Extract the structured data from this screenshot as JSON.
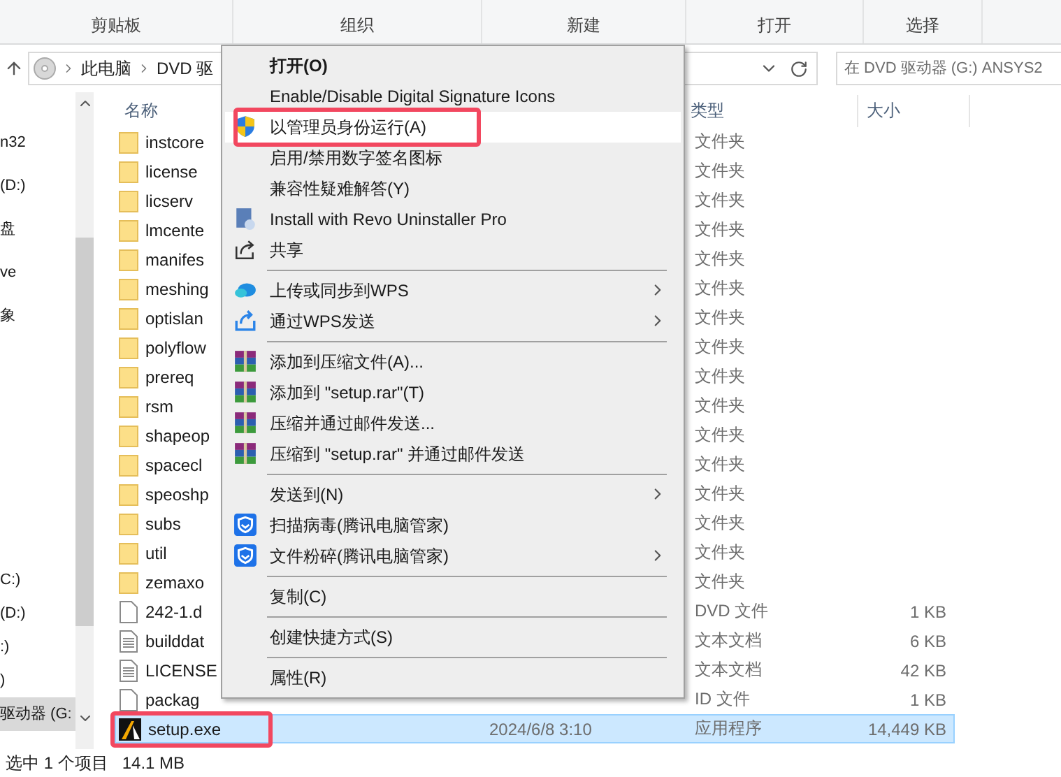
{
  "ribbon_groups": [
    "剪贴板",
    "组织",
    "新建",
    "打开",
    "选择"
  ],
  "address_bar": {
    "crumbs": [
      "此电脑",
      "DVD 驱"
    ]
  },
  "search": {
    "placeholder": "在 DVD 驱动器 (G:) ANSYS2"
  },
  "nav": {
    "upper": [
      {
        "label": "n32",
        "selected": false
      },
      {
        "label": "(D:)",
        "selected": false
      },
      {
        "label": "盘",
        "selected": false
      },
      {
        "label": "ve",
        "selected": false
      },
      {
        "label": "象",
        "selected": false
      }
    ],
    "lower": [
      {
        "label": "C:)",
        "selected": false
      },
      {
        "label": "(D:)",
        "selected": false
      },
      {
        "label": ":)",
        "selected": false
      },
      {
        "label": ")",
        "selected": false
      },
      {
        "label": "驱动器 (G:",
        "selected": true
      }
    ]
  },
  "columns": {
    "name": "名称",
    "type": "类型",
    "size": "大小"
  },
  "files": [
    {
      "kind": "folder",
      "name": "instcore",
      "type": "文件夹",
      "selected": false,
      "annotated": false
    },
    {
      "kind": "folder",
      "name": "license",
      "type": "文件夹",
      "selected": false,
      "annotated": false
    },
    {
      "kind": "folder",
      "name": "licserv",
      "type": "文件夹",
      "selected": false,
      "annotated": false
    },
    {
      "kind": "folder",
      "name": "lmcente",
      "type": "文件夹",
      "selected": false,
      "annotated": false
    },
    {
      "kind": "folder",
      "name": "manifes",
      "type": "文件夹",
      "selected": false,
      "annotated": false
    },
    {
      "kind": "folder",
      "name": "meshing",
      "type": "文件夹",
      "selected": false,
      "annotated": false
    },
    {
      "kind": "folder",
      "name": "optislan",
      "type": "文件夹",
      "selected": false,
      "annotated": false
    },
    {
      "kind": "folder",
      "name": "polyflow",
      "type": "文件夹",
      "selected": false,
      "annotated": false
    },
    {
      "kind": "folder",
      "name": "prereq",
      "type": "文件夹",
      "selected": false,
      "annotated": false
    },
    {
      "kind": "folder",
      "name": "rsm",
      "type": "文件夹",
      "selected": false,
      "annotated": false
    },
    {
      "kind": "folder",
      "name": "shapeop",
      "type": "文件夹",
      "selected": false,
      "annotated": false
    },
    {
      "kind": "folder",
      "name": "spacecl",
      "type": "文件夹",
      "selected": false,
      "annotated": false
    },
    {
      "kind": "folder",
      "name": "speoshp",
      "type": "文件夹",
      "selected": false,
      "annotated": false
    },
    {
      "kind": "folder",
      "name": "subs",
      "type": "文件夹",
      "selected": false,
      "annotated": false
    },
    {
      "kind": "folder",
      "name": "util",
      "type": "文件夹",
      "selected": false,
      "annotated": false
    },
    {
      "kind": "folder",
      "name": "zemaxo",
      "type": "文件夹",
      "selected": false,
      "annotated": false
    },
    {
      "kind": "file",
      "name": "242-1.d",
      "type": "DVD 文件",
      "size": "1 KB",
      "selected": false,
      "annotated": false
    },
    {
      "kind": "text",
      "name": "builddat",
      "type": "文本文档",
      "size": "6 KB",
      "selected": false,
      "annotated": false
    },
    {
      "kind": "text",
      "name": "LICENSE",
      "type": "文本文档",
      "size": "42 KB",
      "selected": false,
      "annotated": false
    },
    {
      "kind": "file",
      "name": "packag",
      "type": "ID 文件",
      "size": "1 KB",
      "selected": false,
      "annotated": false
    },
    {
      "kind": "app",
      "name": "setup.exe",
      "date": "2024/6/8 3:10",
      "type": "应用程序",
      "size": "14,449 KB",
      "selected": true,
      "annotated": true
    }
  ],
  "status_bar": {
    "selection": "选中 1 个项目",
    "size": "14.1 MB"
  },
  "context_menu": [
    {
      "kind": "plain",
      "label": "打开(O)",
      "bold": true,
      "hovered": false,
      "submenu": false,
      "annotated": false
    },
    {
      "kind": "plain",
      "label": "Enable/Disable Digital Signature Icons",
      "bold": false,
      "hovered": false,
      "submenu": false,
      "annotated": false
    },
    {
      "kind": "shield",
      "label": "以管理员身份运行(A)",
      "bold": false,
      "hovered": true,
      "submenu": false,
      "annotated": true
    },
    {
      "kind": "plain",
      "label": "启用/禁用数字签名图标",
      "bold": false,
      "hovered": false,
      "submenu": false,
      "annotated": false
    },
    {
      "kind": "plain",
      "label": "兼容性疑难解答(Y)",
      "bold": false,
      "hovered": false,
      "submenu": false,
      "annotated": false
    },
    {
      "kind": "installer",
      "label": "Install with Revo Uninstaller Pro",
      "bold": false,
      "hovered": false,
      "submenu": false,
      "annotated": false
    },
    {
      "kind": "share",
      "label": "共享",
      "bold": false,
      "hovered": false,
      "submenu": false,
      "annotated": false
    },
    {
      "kind": "separator"
    },
    {
      "kind": "cloud",
      "label": "上传或同步到WPS",
      "bold": false,
      "hovered": false,
      "submenu": true,
      "annotated": false
    },
    {
      "kind": "send",
      "label": "通过WPS发送",
      "bold": false,
      "hovered": false,
      "submenu": true,
      "annotated": false
    },
    {
      "kind": "separator"
    },
    {
      "kind": "archive",
      "label": "添加到压缩文件(A)...",
      "bold": false,
      "hovered": false,
      "submenu": false,
      "annotated": false
    },
    {
      "kind": "archive",
      "label": "添加到 \"setup.rar\"(T)",
      "bold": false,
      "hovered": false,
      "submenu": false,
      "annotated": false
    },
    {
      "kind": "archive",
      "label": "压缩并通过邮件发送...",
      "bold": false,
      "hovered": false,
      "submenu": false,
      "annotated": false
    },
    {
      "kind": "archive",
      "label": "压缩到 \"setup.rar\" 并通过邮件发送",
      "bold": false,
      "hovered": false,
      "submenu": false,
      "annotated": false
    },
    {
      "kind": "separator"
    },
    {
      "kind": "plain",
      "label": "发送到(N)",
      "bold": false,
      "hovered": false,
      "submenu": true,
      "annotated": false
    },
    {
      "kind": "guard",
      "label": "扫描病毒(腾讯电脑管家)",
      "bold": false,
      "hovered": false,
      "submenu": false,
      "annotated": false
    },
    {
      "kind": "guard",
      "label": "文件粉碎(腾讯电脑管家)",
      "bold": false,
      "hovered": false,
      "submenu": true,
      "annotated": false
    },
    {
      "kind": "separator"
    },
    {
      "kind": "plain",
      "label": "复制(C)",
      "bold": false,
      "hovered": false,
      "submenu": false,
      "annotated": false
    },
    {
      "kind": "separator"
    },
    {
      "kind": "plain",
      "label": "创建快捷方式(S)",
      "bold": false,
      "hovered": false,
      "submenu": false,
      "annotated": false
    },
    {
      "kind": "separator"
    },
    {
      "kind": "plain",
      "label": "属性(R)",
      "bold": false,
      "hovered": false,
      "submenu": false,
      "annotated": false
    }
  ]
}
